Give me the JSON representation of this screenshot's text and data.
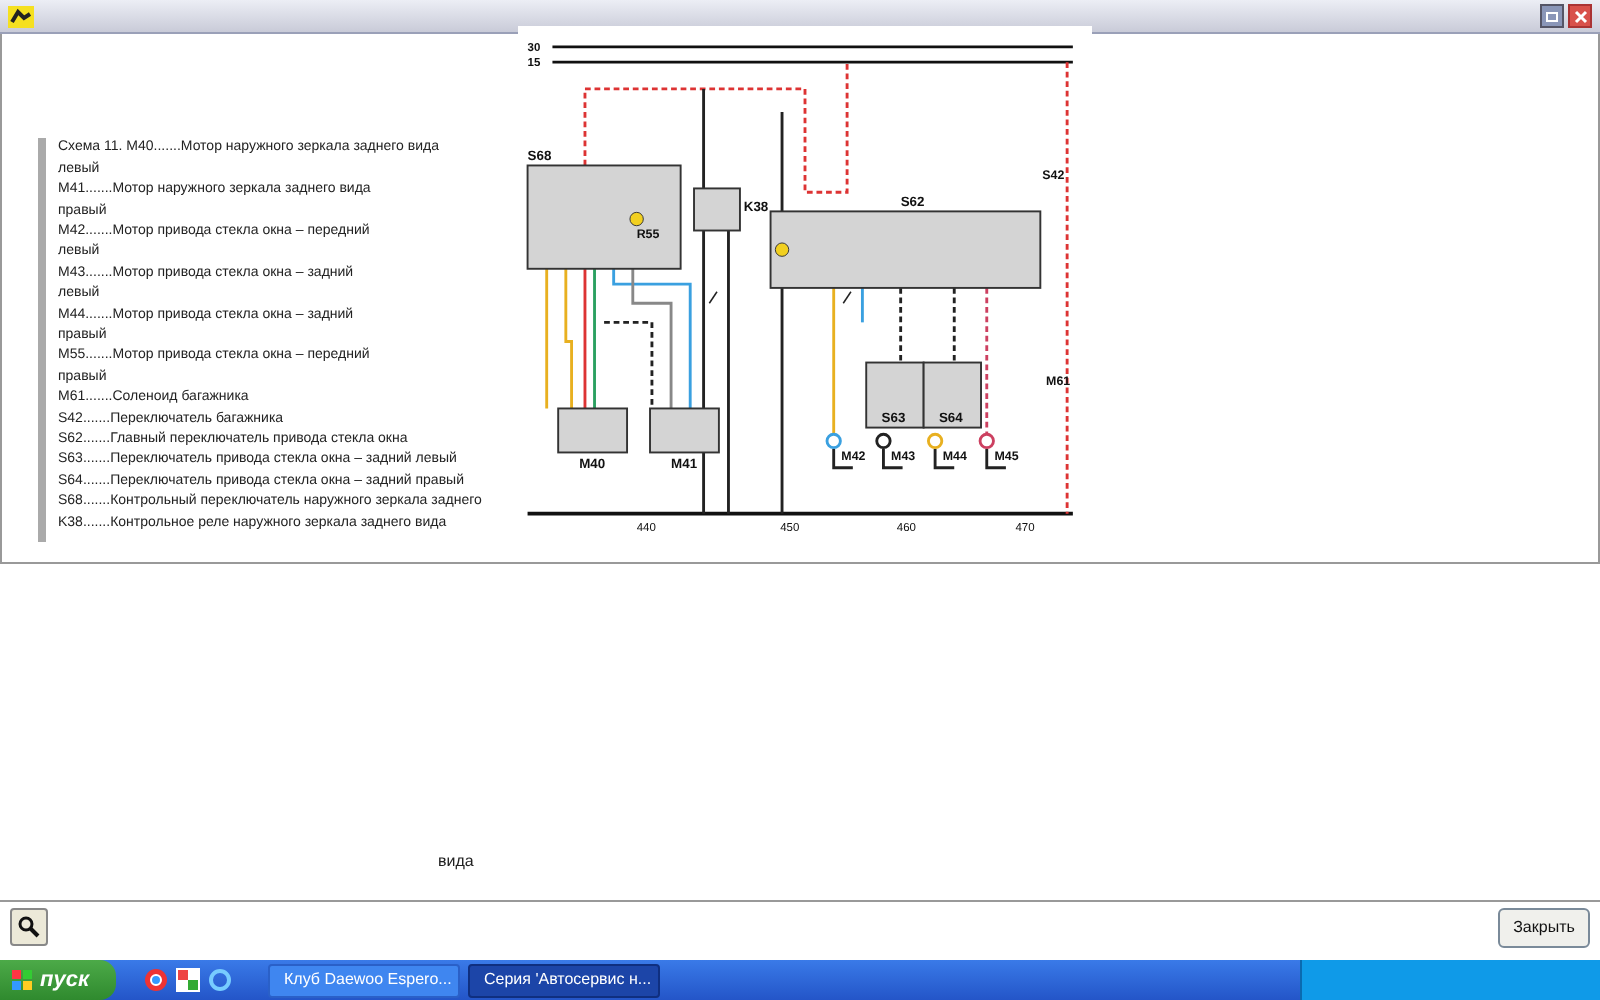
{
  "legend_lines": [
    "Схема 11. M40.......Мотор наружного зеркала заднего вида",
    "левый",
    "M41.......Мотор наружного зеркала заднего вида",
    "правый",
    "M42.......Мотор привода стекла окна – передний",
    "левый",
    "M43.......Мотор привода стекла окна – задний",
    "левый",
    "M44.......Мотор привода стекла окна – задний",
    "правый",
    "M55.......Мотор привода стекла окна – передний",
    "правый",
    "M61.......Соленоид багажника",
    "S42.......Переключатель багажника",
    "S62.......Главный переключатель привода стекла окна",
    "S63.......Переключатель привода стекла окна – задний левый",
    "S64.......Переключатель привода стекла окна – задний правый",
    "S68.......Контрольный переключатель наружного зеркала заднего",
    "K38.......Контрольное реле наружного зеркала заднего вида"
  ],
  "diagram": {
    "bus_labels": [
      "30",
      "15"
    ],
    "modules": [
      "S68",
      "K38",
      "S62",
      "M40",
      "M41",
      "S63",
      "S64"
    ],
    "motors": [
      "M42",
      "M43",
      "M44",
      "M45"
    ],
    "other_labels": [
      "R55",
      "S42",
      "M61"
    ],
    "ticks": [
      "440",
      "450",
      "460",
      "470"
    ]
  },
  "orphan_text": "вида",
  "close_button": "Закрыть",
  "taskbar": {
    "start": "пуск",
    "tasks": [
      {
        "label": "Клуб Daewoo Espero...",
        "selected": false
      },
      {
        "label": "Серия 'Автосервис н...",
        "selected": true
      }
    ]
  }
}
